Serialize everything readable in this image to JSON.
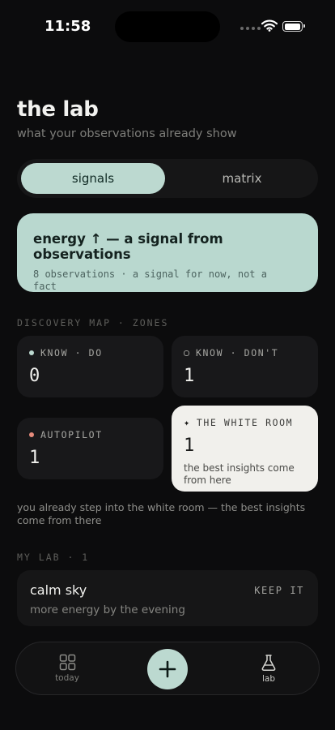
{
  "status_bar": {
    "time": "11:58"
  },
  "header": {
    "title": "the lab",
    "subtitle": "what your observations already show"
  },
  "segmented": {
    "options": [
      "signals",
      "matrix"
    ],
    "selected": "signals"
  },
  "signal_card": {
    "title": "energy ↑ — a signal from observations",
    "meta": "8 observations · a signal for now, not a fact"
  },
  "discovery": {
    "label": "DISCOVERY MAP · ZONES",
    "zones": [
      {
        "label": "KNOW · DO",
        "count": "0",
        "marker": "filled-dot",
        "color": "#bcd9d0"
      },
      {
        "label": "KNOW · DON'T",
        "count": "1",
        "marker": "hollow-dot",
        "color": "#9a9a96"
      },
      {
        "label": "AUTOPILOT",
        "count": "1",
        "marker": "filled-dot",
        "color": "#e58a7b"
      },
      {
        "label": "THE WHITE ROOM",
        "count": "1",
        "marker": "sparkle",
        "note": "the best insights come from here"
      }
    ],
    "insight": "you already step into the white room — the best insights come from there"
  },
  "my_lab": {
    "label": "MY LAB · 1",
    "items": [
      {
        "name": "calm sky",
        "action": "KEEP IT",
        "description": "more energy by the evening"
      }
    ]
  },
  "tab_bar": {
    "tabs": [
      {
        "label": "today",
        "icon": "grid-icon"
      },
      {
        "label": "lab",
        "icon": "flask-icon",
        "active": true
      }
    ],
    "fab_icon": "plus-icon"
  },
  "colors": {
    "accent": "#bcd9d0",
    "background": "#0c0c0d",
    "white_room": "#f1f0ec"
  }
}
